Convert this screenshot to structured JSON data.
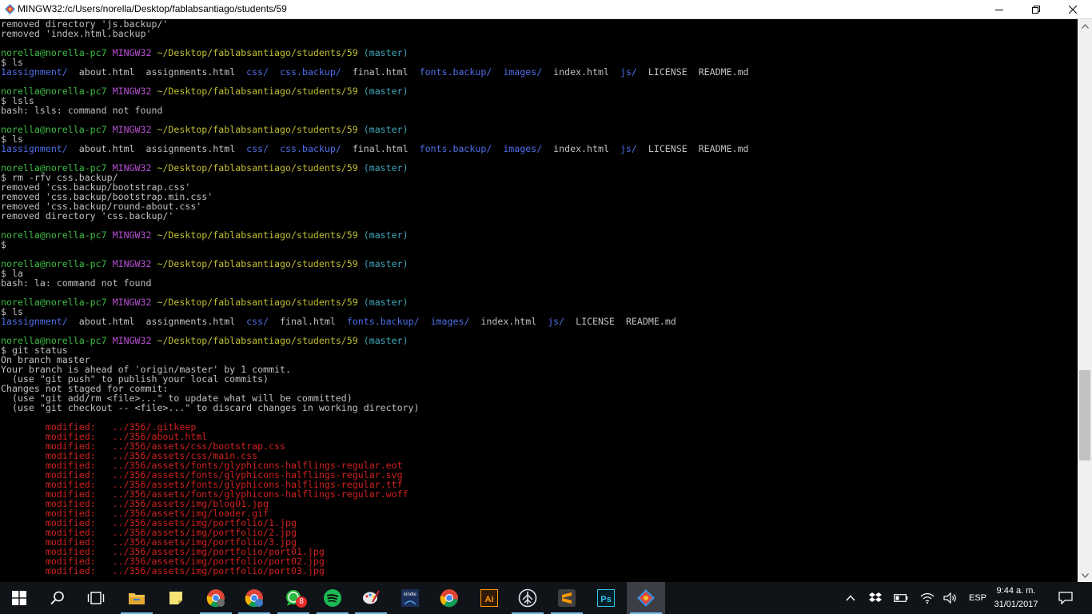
{
  "window": {
    "title": "MINGW32:/c/Users/norella/Desktop/fablabsantiago/students/59",
    "icons": [
      "git-bash-icon",
      "minimize-icon",
      "maximize-icon",
      "close-icon"
    ]
  },
  "prompt": {
    "user_host": "norella@norella-pc7",
    "system": "MINGW32",
    "path": "~/Desktop/fablabsantiago/students/59",
    "branch": "(master)"
  },
  "terminal": {
    "l01": "removed directory 'js.backup/'",
    "l02": "removed 'index.html.backup'",
    "l04": "$ ls",
    "ls1": [
      "1assignment/",
      "about.html",
      "assignments.html",
      "css/",
      "css.backup/",
      "final.html",
      "fonts.backup/",
      "images/",
      "index.html",
      "js/",
      "LICENSE",
      "README.md"
    ],
    "l07": "$ lsls",
    "l08": "bash: lsls: command not found",
    "l11": "$ ls",
    "ls2": [
      "1assignment/",
      "about.html",
      "assignments.html",
      "css/",
      "css.backup/",
      "final.html",
      "fonts.backup/",
      "images/",
      "index.html",
      "js/",
      "LICENSE",
      "README.md"
    ],
    "l15": "$ rm -rfv css.backup/",
    "l16": "removed 'css.backup/bootstrap.css'",
    "l17": "removed 'css.backup/bootstrap.min.css'",
    "l18": "removed 'css.backup/round-about.css'",
    "l19": "removed directory 'css.backup/'",
    "l22": "$",
    "l25": "$ la",
    "l26": "bash: la: command not found",
    "l29": "$ ls",
    "ls3": [
      "1assignment/",
      "about.html",
      "assignments.html",
      "css/",
      "final.html",
      "fonts.backup/",
      "images/",
      "index.html",
      "js/",
      "LICENSE",
      "README.md"
    ],
    "l33": "$ git status",
    "l34": "On branch master",
    "l35": "Your branch is ahead of 'origin/master' by 1 commit.",
    "l36": "  (use \"git push\" to publish your local commits)",
    "l37": "Changes not staged for commit:",
    "l38": "  (use \"git add/rm <file>...\" to update what will be committed)",
    "l39": "  (use \"git checkout -- <file>...\" to discard changes in working directory)",
    "modified_label": "modified:",
    "modified_files": [
      "../356/.gitkeep",
      "../356/about.html",
      "../356/assets/css/bootstrap.css",
      "../356/assets/css/main.css",
      "../356/assets/fonts/glyphicons-halflings-regular.eot",
      "../356/assets/fonts/glyphicons-halflings-regular.svg",
      "../356/assets/fonts/glyphicons-halflings-regular.ttf",
      "../356/assets/fonts/glyphicons-halflings-regular.woff",
      "../356/assets/img/blog01.jpg",
      "../356/assets/img/loader.gif",
      "../356/assets/img/portfolio/1.jpg",
      "../356/assets/img/portfolio/2.jpg",
      "../356/assets/img/portfolio/3.jpg",
      "../356/assets/img/portfolio/port01.jpg",
      "../356/assets/img/portfolio/port02.jpg",
      "../356/assets/img/portfolio/port03.jpg"
    ]
  },
  "colors": {
    "prompt_user": "#3dbc44",
    "prompt_system": "#b54fd0",
    "prompt_path": "#c1bf33",
    "prompt_branch": "#3fa7bb",
    "directory": "#4f6ee8",
    "modified": "#d0211f",
    "text": "#c0c0c0"
  },
  "taskbar": {
    "apps": [
      "windows-start-icon",
      "search-icon",
      "task-view-icon",
      "file-explorer-icon",
      "sticky-notes-icon",
      "chrome-profile-icon",
      "chrome-profile-2-icon",
      "whatsapp-icon",
      "spotify-icon",
      "paint-icon",
      "kindle-icon",
      "chrome-icon",
      "illustrator-icon",
      "network-app-icon",
      "sublime-text-icon",
      "photoshop-icon",
      "git-bash-icon"
    ],
    "whatsapp_badge": "8",
    "illustrator_label": "Ai",
    "photoshop_label": "Ps",
    "kindle_label": "kindle",
    "language": "ESP",
    "time": "9:44 a. m.",
    "date": "31/01/2017"
  }
}
